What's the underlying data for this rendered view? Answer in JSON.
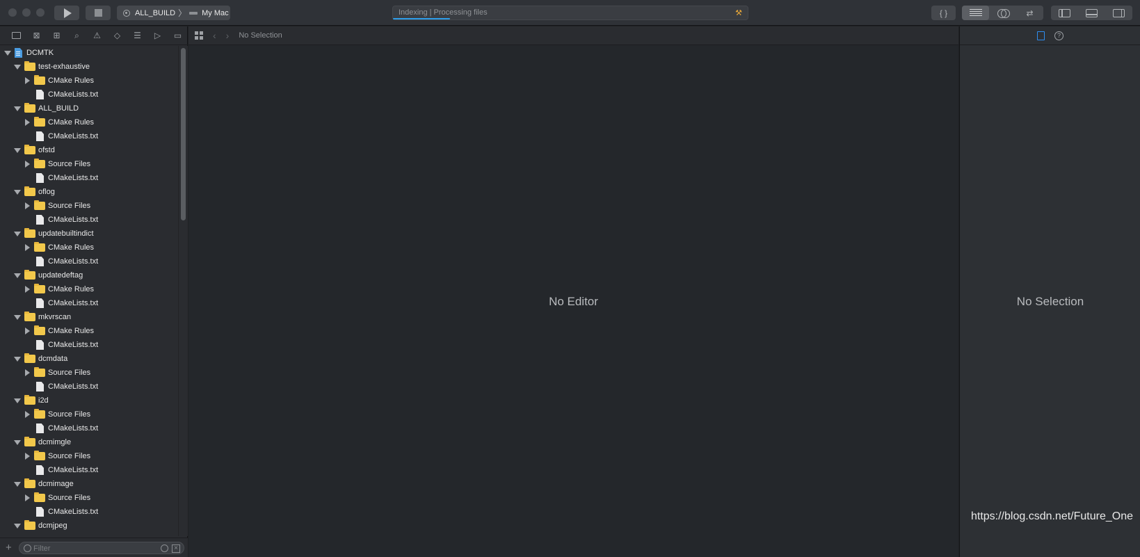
{
  "toolbar": {
    "scheme": {
      "target": "ALL_BUILD",
      "destination": "My Mac"
    },
    "activity": {
      "status": "Indexing | Processing files",
      "progress": 0.16
    }
  },
  "navigator": {
    "filter_placeholder": "Filter",
    "tree": [
      {
        "label": "DCMTK",
        "depth": 0,
        "kind": "project",
        "expanded": true
      },
      {
        "label": "test-exhaustive",
        "depth": 1,
        "kind": "folder",
        "expanded": true
      },
      {
        "label": "CMake Rules",
        "depth": 2,
        "kind": "folder",
        "expanded": false
      },
      {
        "label": "CMakeLists.txt",
        "depth": 2,
        "kind": "file"
      },
      {
        "label": "ALL_BUILD",
        "depth": 1,
        "kind": "folder",
        "expanded": true
      },
      {
        "label": "CMake Rules",
        "depth": 2,
        "kind": "folder",
        "expanded": false
      },
      {
        "label": "CMakeLists.txt",
        "depth": 2,
        "kind": "file"
      },
      {
        "label": "ofstd",
        "depth": 1,
        "kind": "folder",
        "expanded": true
      },
      {
        "label": "Source Files",
        "depth": 2,
        "kind": "folder",
        "expanded": false
      },
      {
        "label": "CMakeLists.txt",
        "depth": 2,
        "kind": "file"
      },
      {
        "label": "oflog",
        "depth": 1,
        "kind": "folder",
        "expanded": true
      },
      {
        "label": "Source Files",
        "depth": 2,
        "kind": "folder",
        "expanded": false
      },
      {
        "label": "CMakeLists.txt",
        "depth": 2,
        "kind": "file"
      },
      {
        "label": "updatebuiltindict",
        "depth": 1,
        "kind": "folder",
        "expanded": true
      },
      {
        "label": "CMake Rules",
        "depth": 2,
        "kind": "folder",
        "expanded": false
      },
      {
        "label": "CMakeLists.txt",
        "depth": 2,
        "kind": "file"
      },
      {
        "label": "updatedeftag",
        "depth": 1,
        "kind": "folder",
        "expanded": true
      },
      {
        "label": "CMake Rules",
        "depth": 2,
        "kind": "folder",
        "expanded": false
      },
      {
        "label": "CMakeLists.txt",
        "depth": 2,
        "kind": "file"
      },
      {
        "label": "mkvrscan",
        "depth": 1,
        "kind": "folder",
        "expanded": true
      },
      {
        "label": "CMake Rules",
        "depth": 2,
        "kind": "folder",
        "expanded": false
      },
      {
        "label": "CMakeLists.txt",
        "depth": 2,
        "kind": "file"
      },
      {
        "label": "dcmdata",
        "depth": 1,
        "kind": "folder",
        "expanded": true
      },
      {
        "label": "Source Files",
        "depth": 2,
        "kind": "folder",
        "expanded": false
      },
      {
        "label": "CMakeLists.txt",
        "depth": 2,
        "kind": "file"
      },
      {
        "label": "i2d",
        "depth": 1,
        "kind": "folder",
        "expanded": true
      },
      {
        "label": "Source Files",
        "depth": 2,
        "kind": "folder",
        "expanded": false
      },
      {
        "label": "CMakeLists.txt",
        "depth": 2,
        "kind": "file"
      },
      {
        "label": "dcmimgle",
        "depth": 1,
        "kind": "folder",
        "expanded": true
      },
      {
        "label": "Source Files",
        "depth": 2,
        "kind": "folder",
        "expanded": false
      },
      {
        "label": "CMakeLists.txt",
        "depth": 2,
        "kind": "file"
      },
      {
        "label": "dcmimage",
        "depth": 1,
        "kind": "folder",
        "expanded": true
      },
      {
        "label": "Source Files",
        "depth": 2,
        "kind": "folder",
        "expanded": false
      },
      {
        "label": "CMakeLists.txt",
        "depth": 2,
        "kind": "file"
      },
      {
        "label": "dcmjpeg",
        "depth": 1,
        "kind": "folder",
        "expanded": true
      }
    ]
  },
  "editor": {
    "jump_bar_text": "No Selection",
    "placeholder": "No Editor"
  },
  "inspector": {
    "placeholder": "No Selection"
  },
  "watermark": "https://blog.csdn.net/Future_One",
  "colors": {
    "accent": "#2e9eea",
    "folder": "#f2c84b",
    "hammer": "#e8a83a"
  }
}
